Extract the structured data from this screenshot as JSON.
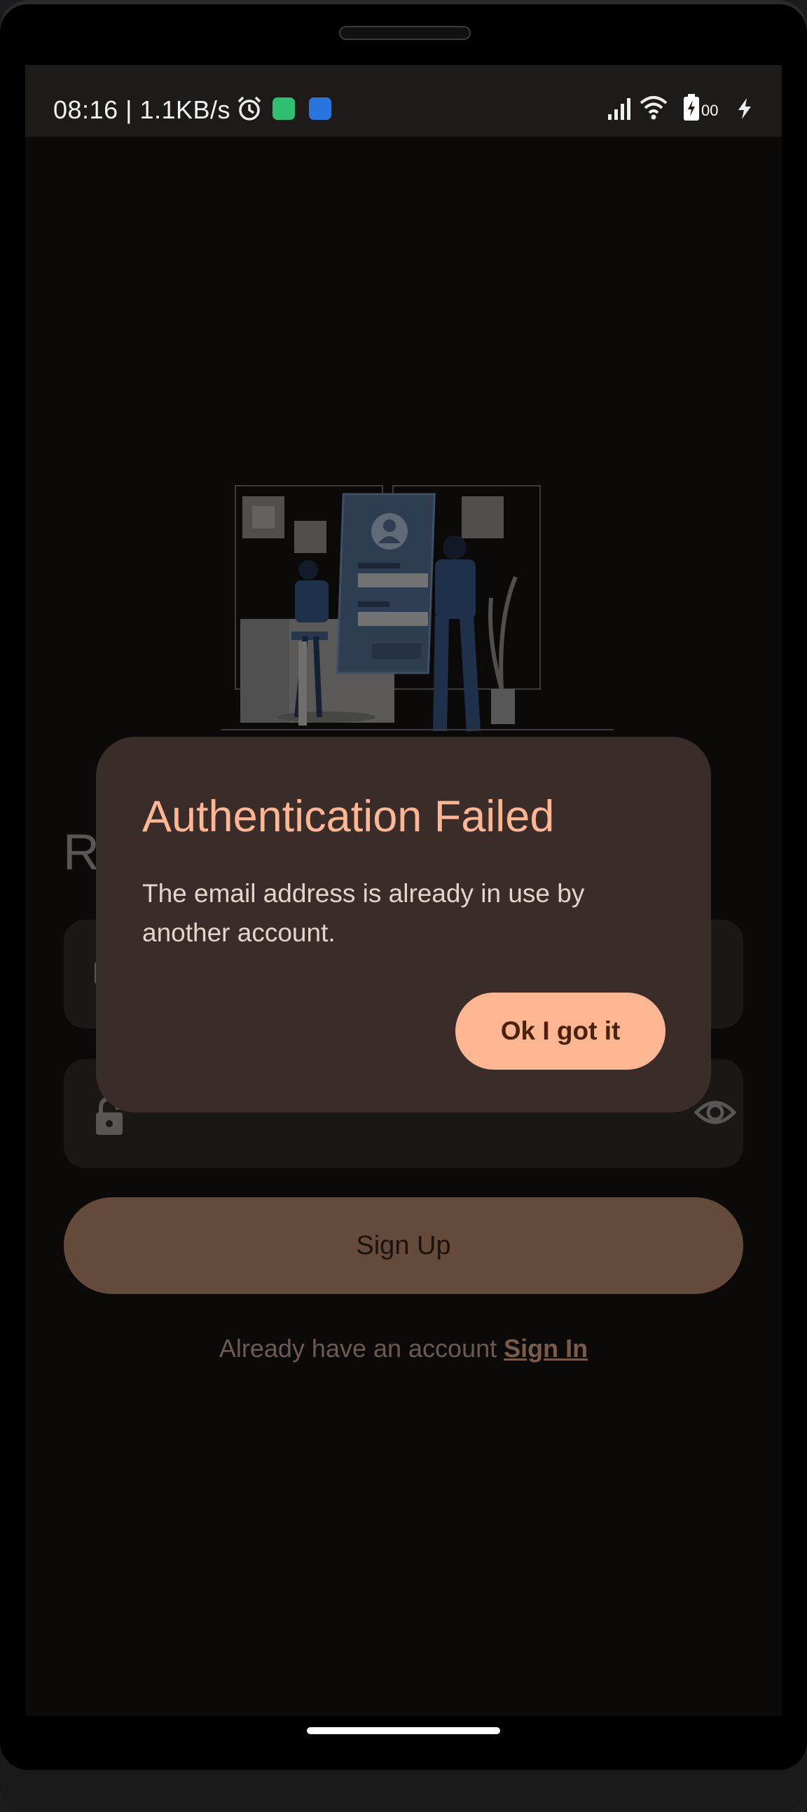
{
  "status_bar": {
    "time_speed": "08:16 | 1.1KB/s",
    "battery_level": "00",
    "icons": [
      "alarm-icon",
      "android-app-icon",
      "twitter-app-icon",
      "signal-icon",
      "wifi-icon",
      "battery-charging-icon",
      "charging-bolt-icon"
    ]
  },
  "screen": {
    "title_partial": "R",
    "email_field": {
      "icon": "email-icon",
      "value": ""
    },
    "password_field": {
      "icon": "lock-icon",
      "toggle_icon": "eye-icon",
      "value": ""
    },
    "signup_label": "Sign Up",
    "signin_prompt": "Already have an account ",
    "signin_link": "Sign In",
    "illustration": "login-illustration"
  },
  "dialog": {
    "title": "Authentication Failed",
    "message": "The email address is already in use by another account.",
    "confirm_label": "Ok I got it"
  },
  "colors": {
    "dialog_bg": "#3a2d29",
    "accent": "#ffb693",
    "signup_button": "#644a3b",
    "screen_bg": "#0c0a09"
  }
}
